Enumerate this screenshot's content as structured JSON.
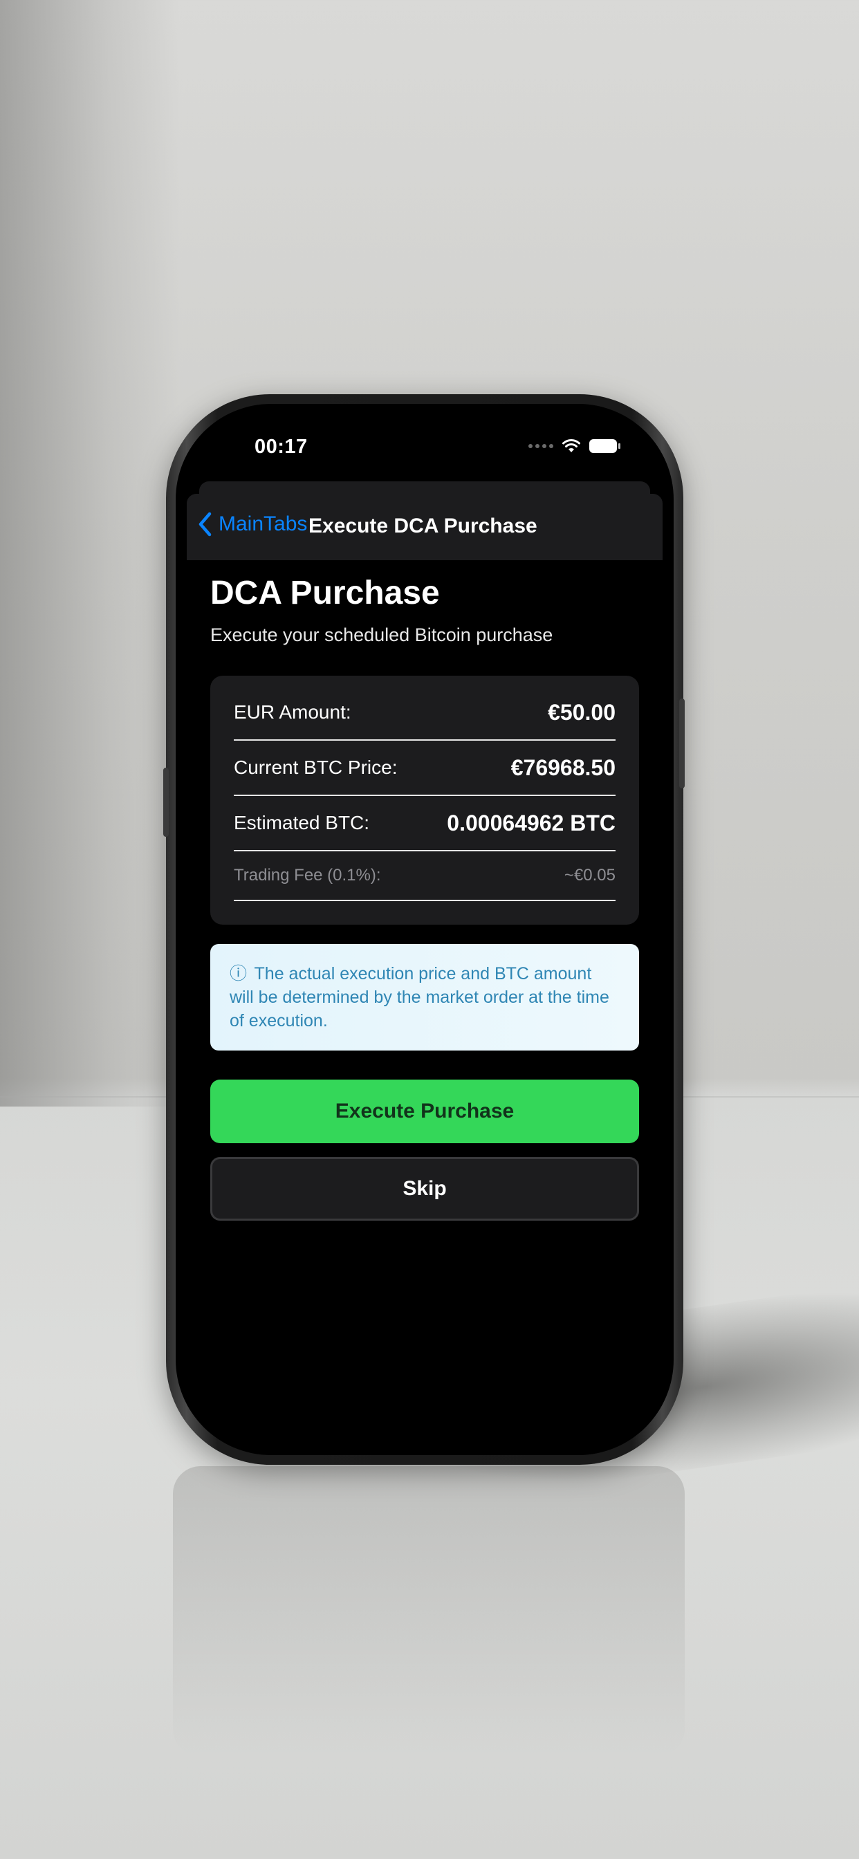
{
  "status_bar": {
    "time": "00:17"
  },
  "nav": {
    "back_label": "MainTabs",
    "title": "Execute DCA Purchase"
  },
  "header": {
    "title": "DCA Purchase",
    "subtitle": "Execute your scheduled Bitcoin purchase"
  },
  "summary": {
    "rows": [
      {
        "label": "EUR Amount:",
        "value": "€50.00"
      },
      {
        "label": "Current BTC Price:",
        "value": "€76968.50"
      },
      {
        "label": "Estimated BTC:",
        "value": "0.00064962 BTC"
      },
      {
        "label": "Trading Fee (0.1%):",
        "value": "~€0.05"
      }
    ]
  },
  "info": {
    "icon": "ⓘ",
    "text": "The actual execution price and BTC amount will be determined by the market order at the time of execution."
  },
  "actions": {
    "primary_label": "Execute Purchase",
    "secondary_label": "Skip"
  },
  "colors": {
    "accent_blue": "#0a84ff",
    "primary_green": "#34d759",
    "info_text": "#2f86b4",
    "card_bg": "#1c1c1e"
  },
  "icons": {
    "back": "chevron-left-icon",
    "wifi": "wifi-icon",
    "battery": "battery-icon",
    "signal": "signal-icon",
    "info": "info-icon"
  }
}
